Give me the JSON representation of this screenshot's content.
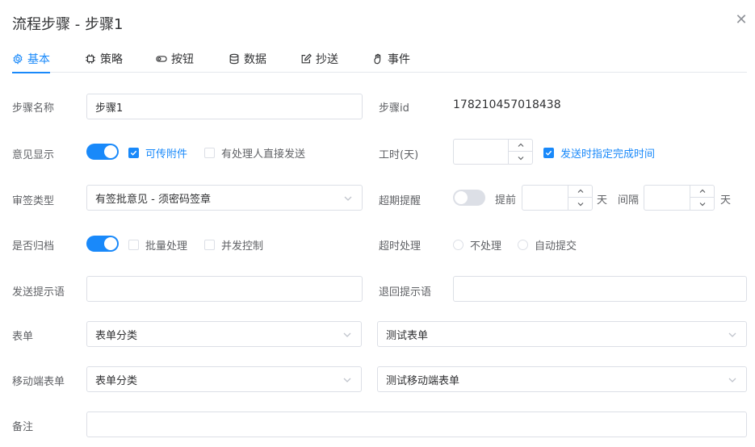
{
  "dialog": {
    "title": "流程步骤 - 步骤1"
  },
  "tabs": [
    {
      "label": "基本",
      "icon": "gear-icon"
    },
    {
      "label": "策略",
      "icon": "chip-icon"
    },
    {
      "label": "按钮",
      "icon": "toggle-icon"
    },
    {
      "label": "数据",
      "icon": "database-icon"
    },
    {
      "label": "抄送",
      "icon": "edit-icon"
    },
    {
      "label": "事件",
      "icon": "hand-icon"
    }
  ],
  "form": {
    "step_name": {
      "label": "步骤名称",
      "value": "步骤1"
    },
    "step_id": {
      "label": "步骤id",
      "value": "178210457018438"
    },
    "opinion_display": {
      "label": "意见显示",
      "attach_label": "可传附件",
      "direct_send_label": "有处理人直接发送"
    },
    "work_hours": {
      "label": "工时(天)",
      "value": "",
      "specify_time_label": "发送时指定完成时间"
    },
    "sign_type": {
      "label": "审签类型",
      "value": "有签批意见 - 须密码签章"
    },
    "overdue_remind": {
      "label": "超期提醒",
      "before_label": "提前",
      "unit_day": "天",
      "interval_label": "间隔",
      "unit_day2": "天"
    },
    "archive": {
      "label": "是否归档",
      "batch_label": "批量处理",
      "concurrent_label": "并发控制"
    },
    "timeout_handle": {
      "label": "超时处理",
      "options": [
        "不处理",
        "自动提交"
      ]
    },
    "send_tip": {
      "label": "发送提示语",
      "value": ""
    },
    "return_tip": {
      "label": "退回提示语",
      "value": ""
    },
    "form_sel": {
      "label": "表单",
      "category": "表单分类",
      "form": "测试表单"
    },
    "mobile_form": {
      "label": "移动端表单",
      "category": "表单分类",
      "form": "测试移动端表单"
    },
    "remark": {
      "label": "备注",
      "value": ""
    }
  },
  "colors": {
    "primary": "#1989fa",
    "border": "#dcdfe6",
    "text": "#303133",
    "label": "#606266"
  }
}
